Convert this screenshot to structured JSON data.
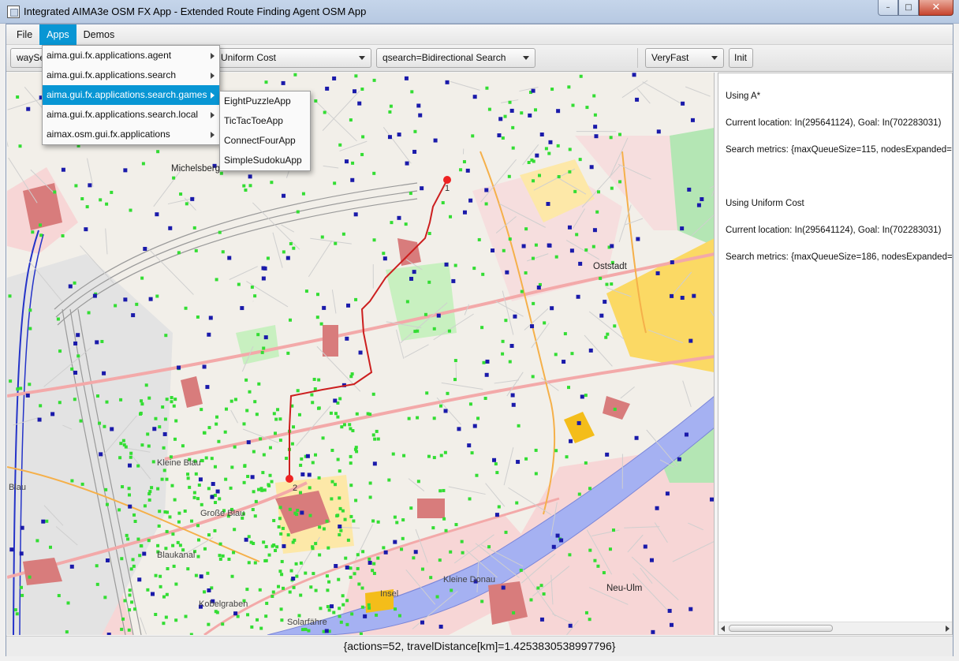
{
  "window": {
    "title": "Integrated AIMA3e OSM FX App - Extended Route Finding Agent OSM App",
    "minimize": "–",
    "maximize": "□",
    "close": "✕"
  },
  "menubar": {
    "items": [
      {
        "label": "File",
        "active": false
      },
      {
        "label": "Apps",
        "active": true
      },
      {
        "label": "Demos",
        "active": false
      }
    ]
  },
  "toolbar": {
    "combo1": "waySe",
    "combo2": "Uniform Cost",
    "combo3": "qsearch=Bidirectional Search",
    "speed": "VeryFast",
    "init_button": "Init"
  },
  "apps_menu": {
    "items": [
      {
        "label": "aima.gui.fx.applications.agent",
        "highlighted": false
      },
      {
        "label": "aima.gui.fx.applications.search",
        "highlighted": false
      },
      {
        "label": "aima.gui.fx.applications.search.games",
        "highlighted": true
      },
      {
        "label": "aima.gui.fx.applications.search.local",
        "highlighted": false
      },
      {
        "label": "aimax.osm.gui.fx.applications",
        "highlighted": false
      }
    ]
  },
  "games_submenu": {
    "items": [
      "EightPuzzleApp",
      "TicTacToeApp",
      "ConnectFourApp",
      "SimpleSudokuApp"
    ]
  },
  "map": {
    "labels": [
      "Michelsberg",
      "Oststadt",
      "Neu-Ulm",
      "Kleine Donau",
      "Insel",
      "Kobelgraben",
      "Solarfähre",
      "Blau",
      "Kleine Blau",
      "Große Blau",
      "Blaukanal"
    ],
    "markers": {
      "start": "1",
      "goal": "2"
    },
    "colors": {
      "route": "#cc1f1f",
      "nodes": "#33dd33",
      "poi": "#1a1aaa",
      "river": "#9aa6ef",
      "residential": "#f5d2d2",
      "buildings": "#d97575",
      "park": "#b7eab7",
      "commercial": "#ffd84a"
    }
  },
  "info_panel": {
    "lines": [
      "Using A*",
      "Current location: In(295641124), Goal: In(702283031)",
      "Search metrics: {maxQueueSize=115, nodesExpanded=",
      "Using Uniform Cost",
      "Current location: In(295641124), Goal: In(702283031)",
      "Search metrics: {maxQueueSize=186, nodesExpanded="
    ]
  },
  "status": {
    "text": "{actions=52, travelDistance[km]=1.4253830538997796}"
  }
}
